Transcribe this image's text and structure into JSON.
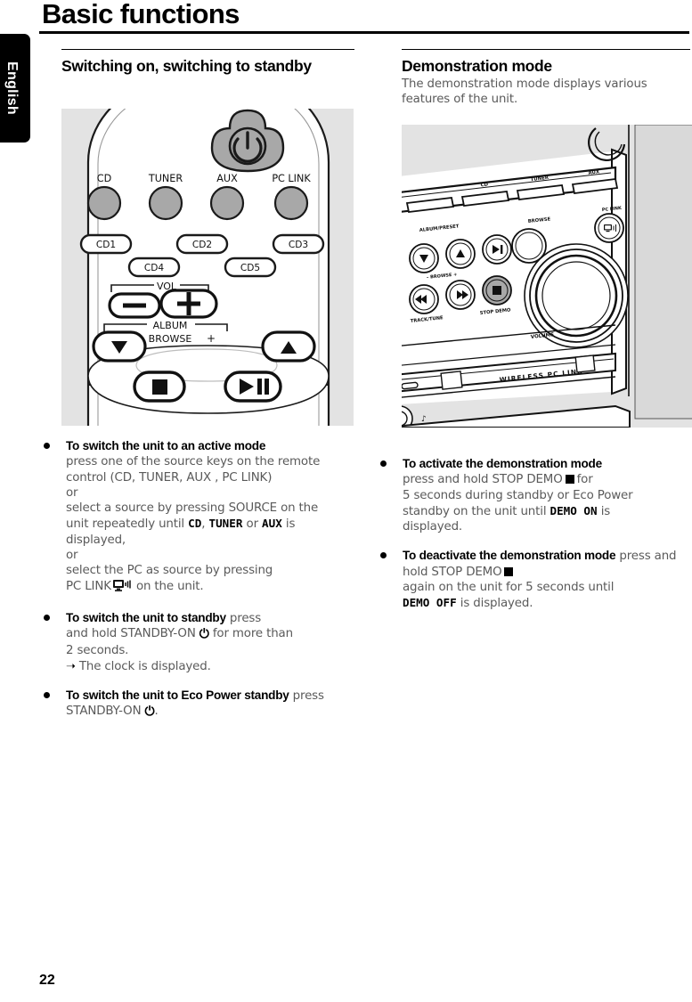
{
  "page": {
    "title": "Basic functions",
    "number": "22",
    "language_tab": "English"
  },
  "left_column": {
    "heading": "Switching on, switching to standby",
    "figure": {
      "name": "remote-control-diagram",
      "power_button_label": "power-standby",
      "source_keys": [
        "CD",
        "TUNER",
        "AUX",
        "PC LINK"
      ],
      "disc_keys": [
        "CD1",
        "CD2",
        "CD3",
        "CD4",
        "CD5"
      ],
      "volume_label": "VOL",
      "volume_minus": "–",
      "volume_plus": "+",
      "album_label": "ALBUM",
      "browse_label": "BROWSE",
      "browse_minus": "–",
      "browse_plus": "+",
      "stop_label": "stop",
      "play_pause_label": "play-pause"
    },
    "bullets": [
      {
        "lead": "To switch the unit to an active mode",
        "lines": [
          "press one of the source keys on the remote",
          "control (CD, TUNER, AUX , PC  LINK)",
          "or",
          "select a source by pressing SOURCE on the",
          "unit repeatedly until ",
          "displayed,",
          "or",
          "select the PC as source by pressing",
          "PC  LINK"
        ],
        "lcd_terms": [
          "CD",
          "TUNER",
          "AUX"
        ],
        "tail_after_lcd": " is",
        "tail_end": " on the unit."
      },
      {
        "lead": "To switch the unit to standby",
        "text_after_lead": " press",
        "lines": [
          "and hold STANDBY-ON",
          "for more than",
          "2 seconds."
        ],
        "result": "The clock is displayed."
      },
      {
        "lead": "To switch the unit to Eco Power standby",
        "text_after_lead": " press STANDBY-ON",
        "tail": "."
      }
    ]
  },
  "right_column": {
    "heading": "Demonstration mode",
    "intro": "The demonstration mode displays various features of the unit.",
    "figure": {
      "name": "unit-front-panel-diagram",
      "source_labels": [
        "CD",
        "TUNER",
        "AUX"
      ],
      "pc_link_label": "PC LINK",
      "album_preset_label": "ALBUM/PRESET",
      "browse_label": "BROWSE",
      "browse_minus": "–",
      "browse_plus": "+",
      "track_tune_label": "TRACK/TUNE",
      "stop_demo_label": "STOP DEMO",
      "browse_knob_label": "BROWSE",
      "volume_label": "VOLUME",
      "wireless_label": "WIRELESS PC LINK",
      "headphone_label": "headphone-jack"
    },
    "bullets": [
      {
        "lead": "To activate the demonstration mode",
        "lines": [
          "press and hold STOP DEMO",
          "for",
          "5 seconds during standby or Eco Power",
          "standby on the unit until ",
          "is",
          "displayed."
        ],
        "lcd_term": "DEMO ON"
      },
      {
        "lead": "To deactivate the demonstration mode",
        "lines": [
          "press and hold STOP DEMO",
          "again on the unit for 5 seconds until",
          "is displayed."
        ],
        "lcd_term": "DEMO OFF"
      }
    ]
  }
}
